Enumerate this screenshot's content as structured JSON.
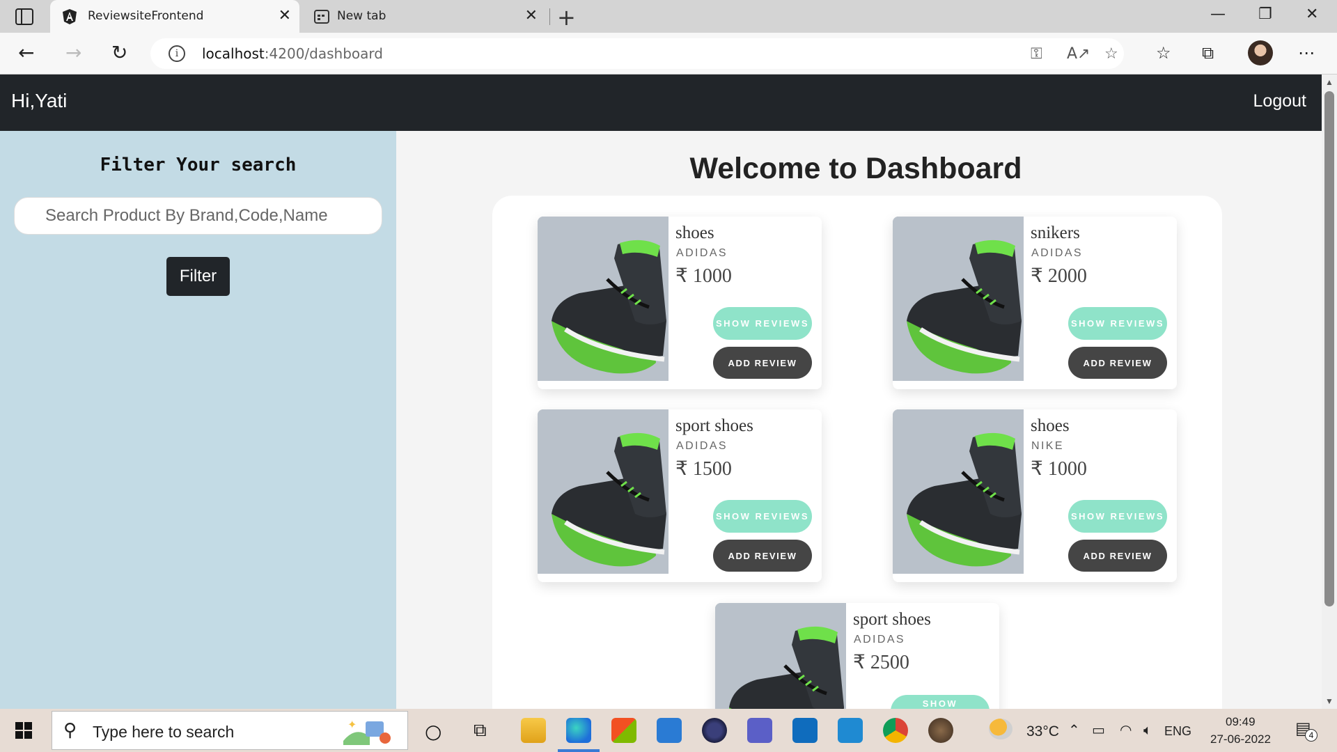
{
  "browser": {
    "tabs": [
      {
        "title": "ReviewsiteFrontend",
        "active": true,
        "icon": "angular-icon"
      },
      {
        "title": "New tab",
        "active": false,
        "icon": "new-tab-page-icon"
      }
    ],
    "url": {
      "host": "localhost",
      "rest": ":4200/dashboard"
    }
  },
  "navbar": {
    "greeting": "Hi,Yati",
    "logout": "Logout"
  },
  "filter": {
    "heading": "Filter Your search",
    "search_placeholder": "Search Product By Brand,Code,Name",
    "button_label": "Filter"
  },
  "dashboard": {
    "title": "Welcome to Dashboard",
    "show_reviews_label": "SHOW REVIEWS",
    "add_review_label": "ADD REVIEW",
    "partial_button_label": "SHOW",
    "products": [
      {
        "name": "shoes",
        "brand": "ADIDAS",
        "price": "₹ 1000"
      },
      {
        "name": "snikers",
        "brand": "ADIDAS",
        "price": "₹ 2000"
      },
      {
        "name": "sport shoes",
        "brand": "ADIDAS",
        "price": "₹ 1500"
      },
      {
        "name": "shoes",
        "brand": "NIKE",
        "price": "₹ 1000"
      },
      {
        "name": "sport shoes",
        "brand": "ADIDAS",
        "price": "₹ 2500"
      }
    ]
  },
  "taskbar": {
    "search_placeholder": "Type here to search",
    "weather": "33°C",
    "language": "ENG",
    "time": "09:49",
    "date": "27-06-2022",
    "notification_count": "4"
  },
  "colors": {
    "navbar": "#212529",
    "filter_panel": "#c3dbe5",
    "show_reviews_button": "#8fe3c9",
    "add_review_button": "#454545"
  }
}
